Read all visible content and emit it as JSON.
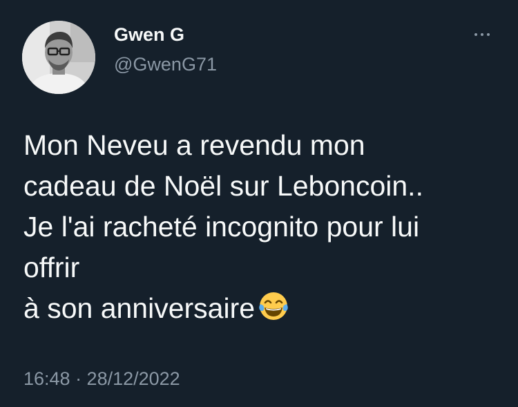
{
  "author": {
    "display_name": "Gwen G",
    "handle": "@GwenG71",
    "avatar_icon": "profile-photo"
  },
  "more_icon": "more-options-icon",
  "tweet": {
    "lines": [
      "Mon Neveu a revendu mon",
      "cadeau de Noël sur Leboncoin..",
      "Je l'ai racheté incognito pour lui",
      "offrir",
      "à son anniversaire"
    ],
    "emoji": "😂"
  },
  "meta": {
    "timestamp": "16:48 · 28/12/2022"
  },
  "colors": {
    "background": "#15202b",
    "primary_text": "#f7f9f9",
    "secondary_text": "#8b98a5"
  }
}
